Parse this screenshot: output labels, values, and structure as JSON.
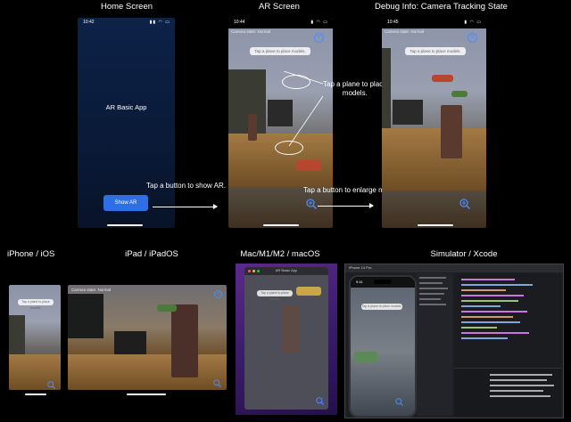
{
  "headings": {
    "home": "Home Screen",
    "ar": "AR Screen",
    "debug": "Debug Info: Camera Tracking State",
    "iphone": "iPhone / iOS",
    "ipad": "iPad / iPadOS",
    "mac": "Mac/M1/M2 / macOS",
    "simulator": "Simulator / Xcode"
  },
  "home_screen": {
    "time": "10:42",
    "app_title": "AR Basic App",
    "show_ar_button": "Show AR"
  },
  "ar_screen": {
    "time": "10:44",
    "camera_state": "Camera state: Normal",
    "hint_pill": "Tap a plane to place models."
  },
  "debug_screen": {
    "time": "10:45",
    "camera_state": "Camera state: Normal",
    "hint_pill": "Tap a plane to place models."
  },
  "annotations": {
    "tap_show_ar": "Tap a button to show AR.",
    "tap_plane": "Tap a plane to place\nmodels.",
    "tap_enlarge": "Tap a button to enlarge models."
  },
  "iphone_small": {
    "hint_pill": "Tap a plane to place models."
  },
  "ipad": {
    "camera_state": "Camera state: Normal"
  },
  "mac": {
    "window_title": "AR Basic App",
    "hint_pill": "Tap a plane to place models."
  },
  "simulator": {
    "device_label": "iPhone 14 Pro",
    "time": "9:41",
    "hint_pill": "Tap a plane to place models."
  },
  "icons": {
    "close": "close-circle-icon",
    "zoom": "magnifier-plus-icon"
  },
  "colors": {
    "accent": "#4a8cff",
    "button": "#2f6fe6",
    "mac_purple": "#5b2a8c"
  }
}
